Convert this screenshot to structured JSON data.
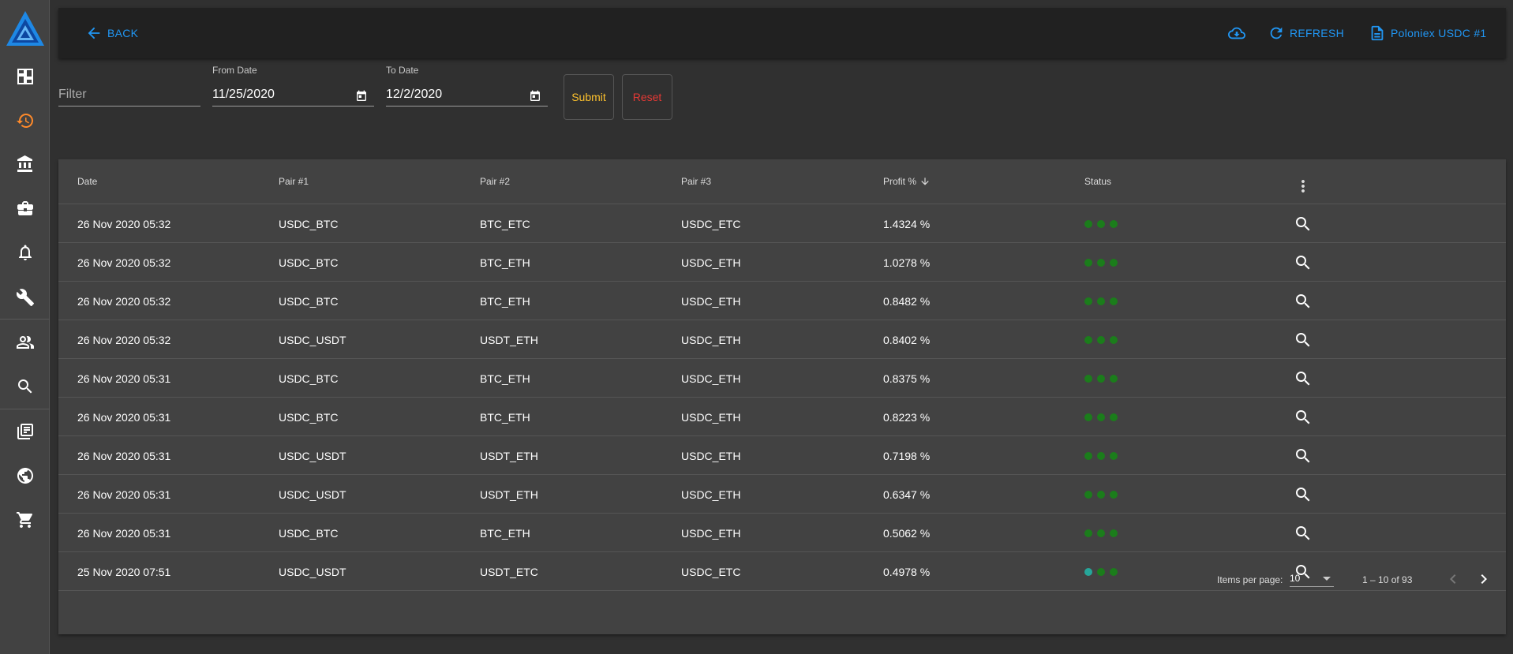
{
  "sidebar": {
    "items": [
      {
        "name": "dashboard-icon"
      },
      {
        "name": "history-icon"
      },
      {
        "name": "bank-icon"
      },
      {
        "name": "briefcase-icon"
      },
      {
        "name": "bell-icon"
      },
      {
        "name": "wrench-icon"
      },
      {
        "name": "people-icon"
      },
      {
        "name": "search-icon"
      },
      {
        "name": "library-icon"
      },
      {
        "name": "globe-icon"
      },
      {
        "name": "cart-icon"
      }
    ],
    "active_index": 1,
    "accent": "#ff8a2a"
  },
  "topbar": {
    "back_label": "BACK",
    "refresh_label": "REFRESH",
    "account_label": "Poloniex USDC #1",
    "accent": "#2196f3"
  },
  "filters": {
    "filter_placeholder": "Filter",
    "from_label": "From Date",
    "from_value": "11/25/2020",
    "to_label": "To Date",
    "to_value": "12/2/2020",
    "submit_label": "Submit",
    "reset_label": "Reset",
    "submit_color": "#fbc02d",
    "reset_color": "#e53935"
  },
  "table": {
    "columns": [
      "Date",
      "Pair #1",
      "Pair #2",
      "Pair #3",
      "Profit %",
      "Status"
    ],
    "sort_column": "Profit %",
    "sort_direction": "desc",
    "rows": [
      {
        "date": "26 Nov 2020 05:32",
        "p1": "USDC_BTC",
        "p2": "BTC_ETC",
        "p3": "USDC_ETC",
        "profit": "1.4324 %",
        "status": [
          "green",
          "green",
          "green"
        ]
      },
      {
        "date": "26 Nov 2020 05:32",
        "p1": "USDC_BTC",
        "p2": "BTC_ETH",
        "p3": "USDC_ETH",
        "profit": "1.0278 %",
        "status": [
          "green",
          "green",
          "green"
        ]
      },
      {
        "date": "26 Nov 2020 05:32",
        "p1": "USDC_BTC",
        "p2": "BTC_ETH",
        "p3": "USDC_ETH",
        "profit": "0.8482 %",
        "status": [
          "green",
          "green",
          "green"
        ]
      },
      {
        "date": "26 Nov 2020 05:32",
        "p1": "USDC_USDT",
        "p2": "USDT_ETH",
        "p3": "USDC_ETH",
        "profit": "0.8402 %",
        "status": [
          "green",
          "green",
          "green"
        ]
      },
      {
        "date": "26 Nov 2020 05:31",
        "p1": "USDC_BTC",
        "p2": "BTC_ETH",
        "p3": "USDC_ETH",
        "profit": "0.8375 %",
        "status": [
          "green",
          "green",
          "green"
        ]
      },
      {
        "date": "26 Nov 2020 05:31",
        "p1": "USDC_BTC",
        "p2": "BTC_ETH",
        "p3": "USDC_ETH",
        "profit": "0.8223 %",
        "status": [
          "green",
          "green",
          "green"
        ]
      },
      {
        "date": "26 Nov 2020 05:31",
        "p1": "USDC_USDT",
        "p2": "USDT_ETH",
        "p3": "USDC_ETH",
        "profit": "0.7198 %",
        "status": [
          "green",
          "green",
          "green"
        ]
      },
      {
        "date": "26 Nov 2020 05:31",
        "p1": "USDC_USDT",
        "p2": "USDT_ETH",
        "p3": "USDC_ETH",
        "profit": "0.6347 %",
        "status": [
          "green",
          "green",
          "green"
        ]
      },
      {
        "date": "26 Nov 2020 05:31",
        "p1": "USDC_BTC",
        "p2": "BTC_ETH",
        "p3": "USDC_ETH",
        "profit": "0.5062 %",
        "status": [
          "green",
          "green",
          "green"
        ]
      },
      {
        "date": "25 Nov 2020 07:51",
        "p1": "USDC_USDT",
        "p2": "USDT_ETC",
        "p3": "USDC_ETC",
        "profit": "0.4978 %",
        "status": [
          "teal",
          "green",
          "green"
        ]
      }
    ],
    "status_colors": {
      "green": "#1b7d1b",
      "teal": "#26a69a"
    }
  },
  "pagination": {
    "items_per_page_label": "Items per page:",
    "page_size": "10",
    "range_label": "1 – 10 of 93"
  }
}
